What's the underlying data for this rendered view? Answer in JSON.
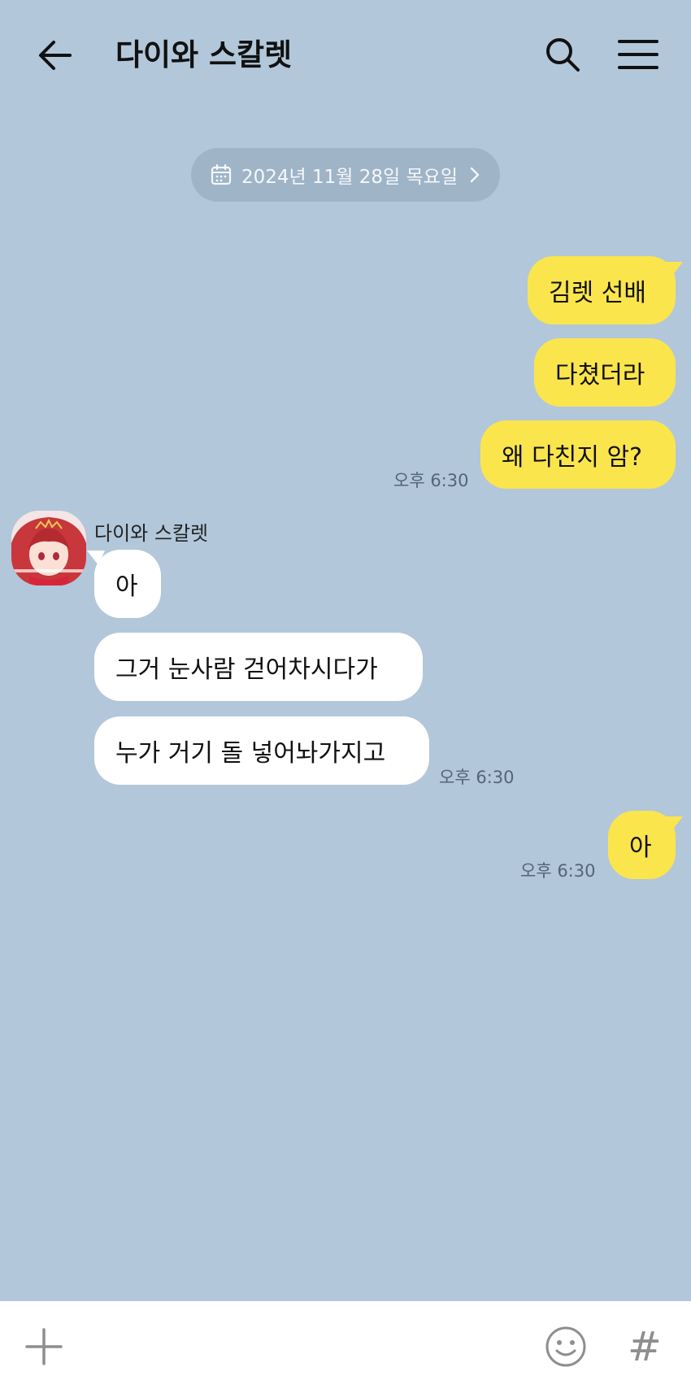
{
  "header": {
    "title": "다이와 스칼렛",
    "back_icon": "arrow-left-icon",
    "search_icon": "search-icon",
    "menu_icon": "hamburger-menu-icon"
  },
  "date_chip": {
    "label": "2024년 11월 28일 목요일",
    "icon": "calendar-icon"
  },
  "messages": {
    "me_1": {
      "text": "김렛 선배"
    },
    "me_2": {
      "text": "다쳤더라"
    },
    "me_3": {
      "text": "왜 다친지 암?"
    },
    "me_time_1": "오후 6:30",
    "sender_name": "다이와 스칼렛",
    "them_1": {
      "text": "아"
    },
    "them_2": {
      "text": "그거 눈사람 걷어차시다가"
    },
    "them_3": {
      "text": "누가 거기 돌 넣어놔가지고"
    },
    "them_time": "오후 6:30",
    "me_4": {
      "text": "아"
    },
    "me_time_2": "오후 6:30"
  },
  "input_bar": {
    "plus_icon": "plus-icon",
    "emoji_icon": "emoji-icon",
    "hash_label": "#"
  },
  "colors": {
    "background": "#b2c7da",
    "my_bubble": "#fbe54d",
    "their_bubble": "#ffffff",
    "date_chip": "#9fb4c7"
  }
}
